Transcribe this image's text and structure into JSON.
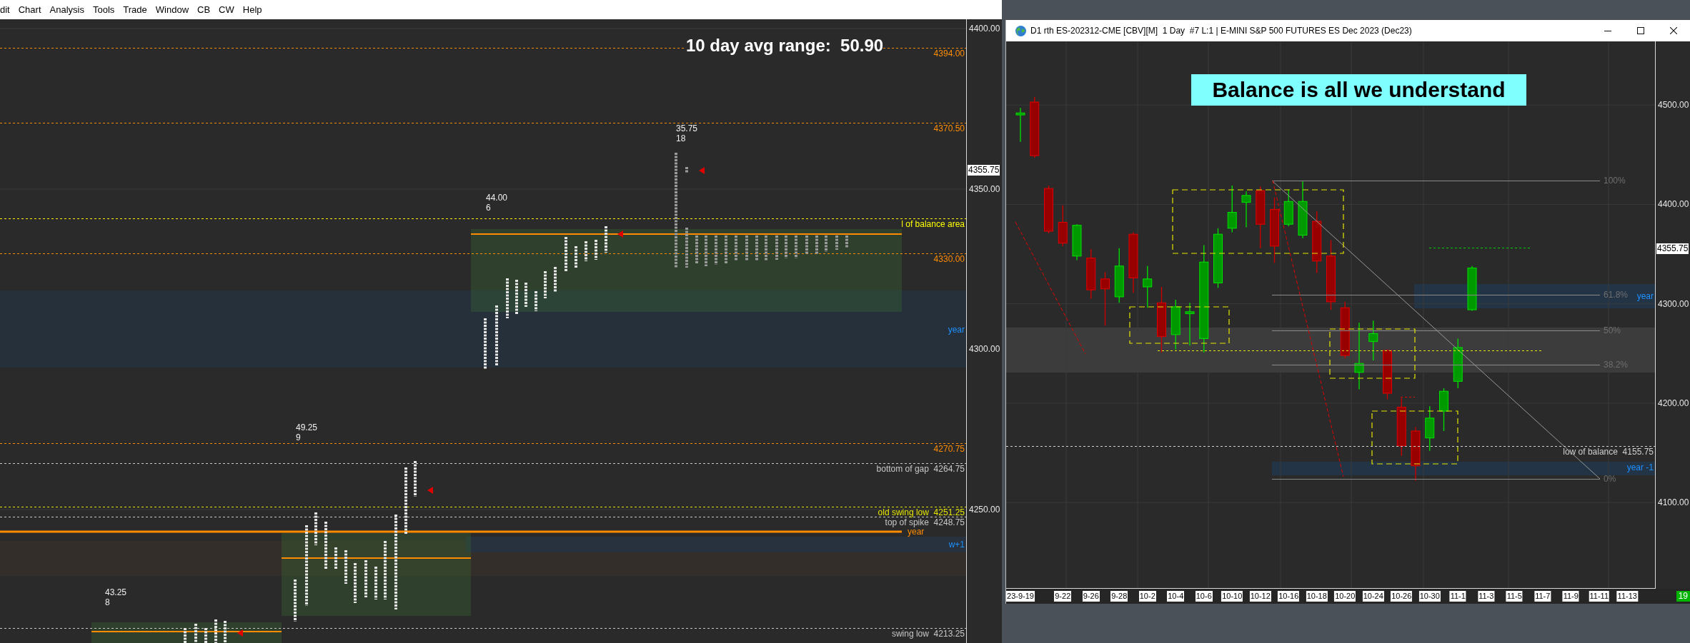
{
  "menu_bar": {
    "items": [
      "dit",
      "Chart",
      "Analysis",
      "Tools",
      "Trade",
      "Window",
      "CB",
      "CW",
      "Help"
    ]
  },
  "main_chart": {
    "headline": "10 day avg range:  50.90",
    "price_axis": [
      "4400.00",
      "4350.00",
      "4300.00",
      "4250.00"
    ],
    "last_price": "4355.75",
    "levels": [
      {
        "label": "4394.00",
        "kind": "dashed",
        "color": "#ff8c00"
      },
      {
        "label": "4370.50",
        "kind": "dashed",
        "color": "#ff8c00"
      },
      {
        "label": "l of balance area",
        "kind": "dashed",
        "color": "#ffff00"
      },
      {
        "label": "4330.00",
        "kind": "dashed",
        "color": "#ff8c00"
      },
      {
        "label": "4270.75",
        "kind": "dashed",
        "color": "#ff8c00"
      },
      {
        "label": "bottom of gap  4264.75",
        "kind": "dashed",
        "color": "#c8c8c8"
      },
      {
        "label": "old swing low  4251.25",
        "kind": "dashed",
        "color": "#e6e600"
      },
      {
        "label": "top of spike  4248.75",
        "kind": "dashed",
        "color": "#c8c8c8"
      },
      {
        "label": "year",
        "kind": "solid",
        "color": "#ff8c00"
      },
      {
        "label": "swing low  4213.25",
        "kind": "dashed",
        "color": "#c8c8c8"
      }
    ],
    "zones": [
      {
        "label": "year"
      },
      {
        "label": "w+1"
      }
    ],
    "profiles": [
      {
        "range": "35.75",
        "count": "18"
      },
      {
        "range": "44.00",
        "count": "6"
      },
      {
        "range": "49.25",
        "count": "9"
      },
      {
        "range": "43.25",
        "count": "8"
      }
    ]
  },
  "chart_window": {
    "title": "D1 rth ES-202312-CME [CBV][M]  1 Day  #7 L:1 | E-MINI S&P 500 FUTURES ES Dec 2023 (Dec23)",
    "banner": "Balance is all we understand",
    "last_price": "4355.75",
    "fib_levels": [
      "100%",
      "61.8%",
      "50%",
      "38.2%",
      "0%"
    ],
    "zones": [
      {
        "label": "year"
      },
      {
        "label": "year -1"
      }
    ],
    "levels": [
      {
        "label": "low of balance  4155.75"
      }
    ],
    "chart_data": {
      "type": "candlestick",
      "grid": true,
      "categories": [
        "23-9-19",
        null,
        null,
        "9-22",
        null,
        "9-26",
        null,
        "9-28",
        null,
        "10-2",
        null,
        "10-4",
        null,
        "10-6",
        null,
        "10-10",
        null,
        "10-12",
        null,
        "10-16",
        null,
        "10-18",
        null,
        "10-20",
        null,
        "10-24",
        null,
        "10-26",
        null,
        "10-30",
        null,
        "11-1",
        null,
        "11-3",
        null,
        "11-5",
        null,
        "11-7",
        null,
        "11-9",
        null,
        "11-11",
        null,
        "11-13",
        null
      ],
      "ohlc": [
        [
          4490,
          4497,
          4463,
          4492
        ],
        [
          4503,
          4508,
          4447,
          4449
        ],
        [
          4416,
          4419,
          4371,
          4373
        ],
        [
          4382,
          4399,
          4358,
          4361
        ],
        [
          4348,
          4380,
          4344,
          4379
        ],
        [
          4346,
          4355,
          4305,
          4314
        ],
        [
          4325,
          4332,
          4278,
          4315
        ],
        [
          4307,
          4356,
          4301,
          4338
        ],
        [
          4370,
          4372,
          4311,
          4326
        ],
        [
          4317,
          4338,
          4296,
          4325
        ],
        [
          4301,
          4317,
          4251,
          4267
        ],
        [
          4269,
          4304,
          4254,
          4297
        ],
        [
          4290,
          4301,
          4258,
          4292
        ],
        [
          4265,
          4359,
          4251,
          4342
        ],
        [
          4321,
          4376,
          4316,
          4370
        ],
        [
          4376,
          4419,
          4372,
          4392
        ],
        [
          4402,
          4413,
          4377,
          4409
        ],
        [
          4414,
          4418,
          4356,
          4380
        ],
        [
          4395,
          4407,
          4341,
          4358
        ],
        [
          4380,
          4415,
          4378,
          4403
        ],
        [
          4369,
          4423,
          4366,
          4403
        ],
        [
          4383,
          4393,
          4331,
          4343
        ],
        [
          4348,
          4364,
          4294,
          4302
        ],
        [
          4296,
          4302,
          4245,
          4248
        ],
        [
          4231,
          4281,
          4214,
          4240
        ],
        [
          4262,
          4283,
          4243,
          4270
        ],
        [
          4253,
          4254,
          4204,
          4210
        ],
        [
          4196,
          4205,
          4147,
          4157
        ],
        [
          4172,
          4176,
          4122,
          4137
        ],
        [
          4165,
          4197,
          4152,
          4185
        ],
        [
          4192,
          4215,
          4172,
          4212
        ],
        [
          4222,
          4265,
          4215,
          4256
        ],
        [
          4294,
          4338,
          4293,
          4336
        ],
        null,
        null,
        null,
        null,
        null,
        null,
        null,
        null,
        null,
        null,
        null,
        null
      ],
      "ylim": [
        4014,
        4564
      ],
      "yticks": [
        {
          "value": 4500,
          "label": "4500.00"
        },
        {
          "value": 4400,
          "label": "4400.00"
        },
        {
          "value": 4300,
          "label": "4300.00"
        },
        {
          "value": 4200,
          "label": "4200.00"
        },
        {
          "value": 4100,
          "label": "4100.00"
        }
      ]
    },
    "corner_badge": "19"
  }
}
